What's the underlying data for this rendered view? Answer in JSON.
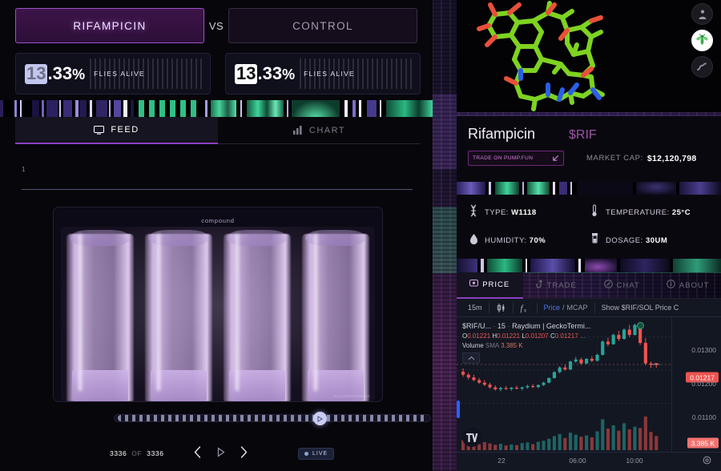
{
  "experiment": {
    "compare": {
      "treatment_label": "RIFAMPICIN",
      "vs_label": "VS",
      "control_label": "CONTROL"
    },
    "stats": [
      {
        "digit": "13",
        "rest": ".33",
        "pct": "%",
        "label": "FLIES ALIVE",
        "value": 13.33,
        "highlight": "lavender"
      },
      {
        "digit": "13",
        "rest": ".33",
        "pct": "%",
        "label": "FLIES ALIVE",
        "value": 13.33,
        "highlight": "white"
      }
    ],
    "tabs": [
      {
        "label": "FEED",
        "icon": "monitor-icon",
        "active": true
      },
      {
        "label": "CHART",
        "icon": "bar-chart-icon",
        "active": false
      }
    ],
    "feed": {
      "counter": "1",
      "video_caption": "compound",
      "watermark": "SciCamSurveillance",
      "vial_count": 4
    },
    "playback": {
      "current_frame": "3336",
      "of_label": "OF",
      "total_frames": "3336",
      "prev_icon": "chevron-left-icon",
      "play_icon": "play-icon",
      "next_icon": "chevron-right-icon",
      "live_label": "LIVE",
      "scrubber_position_pct": 63
    }
  },
  "organism_buttons": [
    {
      "name": "human-icon",
      "active": false
    },
    {
      "name": "fly-icon",
      "active": true
    },
    {
      "name": "worm-icon",
      "active": false
    }
  ],
  "token": {
    "name": "Rifampicin",
    "ticker": "$RIF",
    "pump_button_label": "TRADE ON PUMP.FUN",
    "pump_button_icon": "external-link-arrow-icon",
    "mcap_label": "MARKET CAP:",
    "mcap_value": "$12,120,798",
    "accent_color": "#b05fb8"
  },
  "parameters": [
    {
      "icon": "dna-icon",
      "label": "TYPE:",
      "value": "W1118"
    },
    {
      "icon": "thermometer-icon",
      "label": "TEMPERATURE:",
      "value": "25°C"
    },
    {
      "icon": "droplet-icon",
      "label": "HUMIDITY:",
      "value": "70%"
    },
    {
      "icon": "vial-icon",
      "label": "DOSAGE:",
      "value": "30UM"
    }
  ],
  "right_tabs": [
    {
      "label": "PRICE",
      "icon": "price-tag-icon",
      "active": true
    },
    {
      "label": "TRADE",
      "icon": "swap-icon",
      "active": false
    },
    {
      "label": "CHAT",
      "icon": "chat-icon",
      "active": false
    },
    {
      "label": "ABOUT",
      "icon": "info-icon",
      "active": false
    }
  ],
  "chart_toolbar": {
    "interval": "15m",
    "candle_icon": "candlestick-icon",
    "indicator_icon": "fx-icon",
    "price_label": "Price",
    "slash": "/",
    "mcap_label": "MCAP",
    "show_label": "Show $RIF/SOL Price C"
  },
  "chart_data": {
    "type": "line",
    "symbol": "$RIF/U...",
    "interval_legend": "15",
    "exchange": "Raydium | GeckoTermi...",
    "ohlc": {
      "O": "0.01221",
      "H": "0.01221",
      "L": "0.01207",
      "C": "0.01217"
    },
    "ohlc_suffix": "...",
    "volume_label": "Volume",
    "volume_sma_label": "SMA",
    "volume_value": "3.385 K",
    "last_price_badge": "0.01217",
    "volume_badge": "3.385 K",
    "price_ticks": [
      "0.01300",
      "0.01200",
      "0.01100"
    ],
    "time_ticks": [
      "22",
      "06:00",
      "10:00"
    ],
    "ylim": [
      0.0106,
      0.01345
    ],
    "grid": true,
    "up_color": "#26a69a",
    "down_color": "#ef5350",
    "candles": [
      {
        "o": 0.01195,
        "h": 0.01205,
        "l": 0.0118,
        "c": 0.01186,
        "v": 0.3
      },
      {
        "o": 0.01186,
        "h": 0.01192,
        "l": 0.01172,
        "c": 0.01178,
        "v": 0.22
      },
      {
        "o": 0.01178,
        "h": 0.01186,
        "l": 0.01166,
        "c": 0.0117,
        "v": 0.26
      },
      {
        "o": 0.0117,
        "h": 0.01176,
        "l": 0.01158,
        "c": 0.01162,
        "v": 0.18
      },
      {
        "o": 0.01162,
        "h": 0.0117,
        "l": 0.01152,
        "c": 0.01156,
        "v": 0.24
      },
      {
        "o": 0.01156,
        "h": 0.01162,
        "l": 0.01144,
        "c": 0.01148,
        "v": 0.2
      },
      {
        "o": 0.01148,
        "h": 0.01154,
        "l": 0.01138,
        "c": 0.01142,
        "v": 0.16
      },
      {
        "o": 0.01142,
        "h": 0.0115,
        "l": 0.01136,
        "c": 0.01146,
        "v": 0.19
      },
      {
        "o": 0.01146,
        "h": 0.01152,
        "l": 0.0114,
        "c": 0.01143,
        "v": 0.14
      },
      {
        "o": 0.01143,
        "h": 0.01149,
        "l": 0.01138,
        "c": 0.01147,
        "v": 0.17
      },
      {
        "o": 0.01147,
        "h": 0.01153,
        "l": 0.01142,
        "c": 0.01144,
        "v": 0.15
      },
      {
        "o": 0.01144,
        "h": 0.0115,
        "l": 0.01139,
        "c": 0.01148,
        "v": 0.21
      },
      {
        "o": 0.01148,
        "h": 0.01156,
        "l": 0.01144,
        "c": 0.01152,
        "v": 0.23
      },
      {
        "o": 0.01152,
        "h": 0.01158,
        "l": 0.01146,
        "c": 0.01149,
        "v": 0.18
      },
      {
        "o": 0.01149,
        "h": 0.01157,
        "l": 0.01145,
        "c": 0.01155,
        "v": 0.25
      },
      {
        "o": 0.01155,
        "h": 0.01165,
        "l": 0.01152,
        "c": 0.01162,
        "v": 0.28
      },
      {
        "o": 0.01162,
        "h": 0.01178,
        "l": 0.0116,
        "c": 0.01176,
        "v": 0.34
      },
      {
        "o": 0.01176,
        "h": 0.01196,
        "l": 0.01174,
        "c": 0.01194,
        "v": 0.42
      },
      {
        "o": 0.01194,
        "h": 0.01212,
        "l": 0.0119,
        "c": 0.01208,
        "v": 0.48
      },
      {
        "o": 0.01208,
        "h": 0.01216,
        "l": 0.01198,
        "c": 0.01202,
        "v": 0.36
      },
      {
        "o": 0.01202,
        "h": 0.01228,
        "l": 0.012,
        "c": 0.01226,
        "v": 0.52
      },
      {
        "o": 0.01226,
        "h": 0.0124,
        "l": 0.01222,
        "c": 0.01232,
        "v": 0.46
      },
      {
        "o": 0.01232,
        "h": 0.01238,
        "l": 0.01216,
        "c": 0.0122,
        "v": 0.4
      },
      {
        "o": 0.0122,
        "h": 0.01236,
        "l": 0.01218,
        "c": 0.01234,
        "v": 0.44
      },
      {
        "o": 0.01234,
        "h": 0.01242,
        "l": 0.01224,
        "c": 0.01228,
        "v": 0.38
      },
      {
        "o": 0.01228,
        "h": 0.0125,
        "l": 0.01226,
        "c": 0.01246,
        "v": 0.56
      },
      {
        "o": 0.01246,
        "h": 0.0129,
        "l": 0.01244,
        "c": 0.01286,
        "v": 0.92
      },
      {
        "o": 0.01286,
        "h": 0.01298,
        "l": 0.01272,
        "c": 0.01278,
        "v": 0.64
      },
      {
        "o": 0.01278,
        "h": 0.0131,
        "l": 0.01276,
        "c": 0.01306,
        "v": 0.74
      },
      {
        "o": 0.01306,
        "h": 0.01318,
        "l": 0.01288,
        "c": 0.01294,
        "v": 0.58
      },
      {
        "o": 0.01294,
        "h": 0.01326,
        "l": 0.01292,
        "c": 0.01322,
        "v": 0.8
      },
      {
        "o": 0.01322,
        "h": 0.01336,
        "l": 0.013,
        "c": 0.01306,
        "v": 0.62
      },
      {
        "o": 0.01306,
        "h": 0.0134,
        "l": 0.01304,
        "c": 0.01336,
        "v": 0.7
      },
      {
        "o": 0.01336,
        "h": 0.01342,
        "l": 0.01276,
        "c": 0.01282,
        "v": 0.66
      },
      {
        "o": 0.01282,
        "h": 0.01296,
        "l": 0.01214,
        "c": 0.0122,
        "v": 1.0
      },
      {
        "o": 0.0122,
        "h": 0.01226,
        "l": 0.01206,
        "c": 0.01216,
        "v": 0.54
      },
      {
        "o": 0.01221,
        "h": 0.01221,
        "l": 0.01207,
        "c": 0.01217,
        "v": 0.42
      }
    ]
  }
}
